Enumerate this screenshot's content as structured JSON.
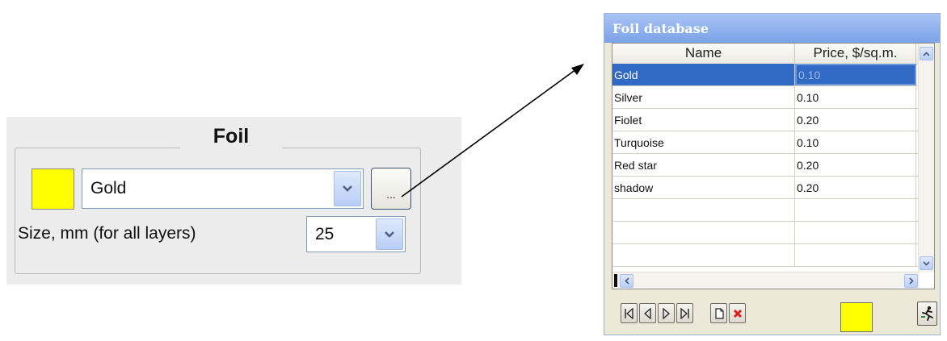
{
  "foil_panel": {
    "title": "Foil",
    "swatch_color": "#ffff00",
    "foil_select": {
      "value": "Gold",
      "icon": "chevron-down-icon"
    },
    "browse_button_label": "...",
    "size_label": "Size, mm (for all layers)",
    "size_select": {
      "value": "25",
      "icon": "chevron-down-icon"
    }
  },
  "foil_database": {
    "title": "Foil database",
    "columns": [
      "Name",
      "Price, $/sq.m."
    ],
    "rows": [
      {
        "name": "Gold",
        "price": "0.10"
      },
      {
        "name": "Silver",
        "price": "0.10"
      },
      {
        "name": "Fiolet",
        "price": "0.20"
      },
      {
        "name": "Turquoise",
        "price": "0.10"
      },
      {
        "name": "Red star",
        "price": "0.20"
      },
      {
        "name": "shadow",
        "price": "0.20"
      },
      {
        "name": "",
        "price": ""
      },
      {
        "name": "",
        "price": ""
      },
      {
        "name": "",
        "price": ""
      }
    ],
    "selected_row": "Gold",
    "swatch_color": "#ffff00",
    "navigator": [
      "first-record-icon",
      "prior-record-icon",
      "next-record-icon",
      "last-record-icon",
      "new-record-icon",
      "delete-record-icon"
    ],
    "exit_icon": "running-man-exit-icon"
  },
  "colors": {
    "selection": "#316ac5",
    "titlebar": "#7ba2e7",
    "delete": "#e41b1b"
  }
}
